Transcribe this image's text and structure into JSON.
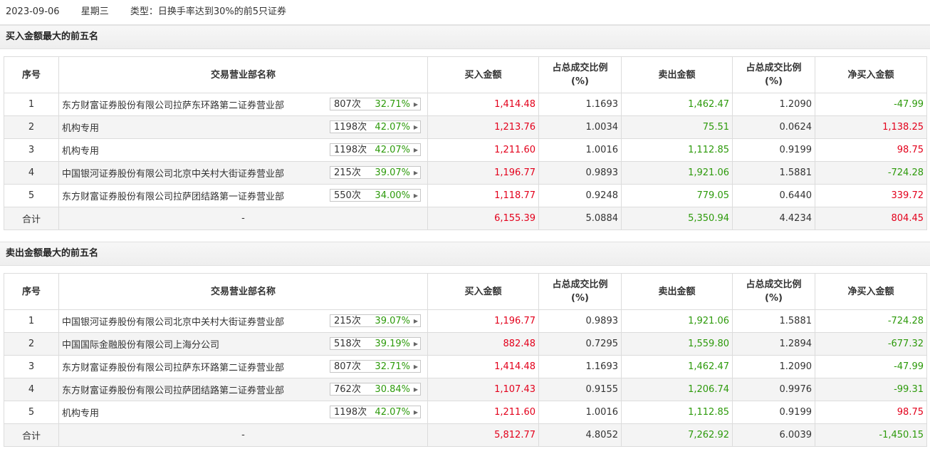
{
  "header": {
    "date": "2023-09-06",
    "weekday": "星期三",
    "type_label": "类型：日换手率达到30%的前5只证券"
  },
  "columns": [
    "序号",
    "交易营业部名称",
    "买入金额",
    "占总成交比例\n(%)",
    "卖出金额",
    "占总成交比例\n(%)",
    "净买入金额"
  ],
  "buy_section": {
    "title": "买入金额最大的前五名",
    "rows": [
      {
        "idx": "1",
        "name": "东方财富证券股份有限公司拉萨东环路第二证券营业部",
        "count": "807次",
        "pct": "32.71%",
        "buy": "1,414.48",
        "buy_ratio": "1.1693",
        "sell": "1,462.47",
        "sell_ratio": "1.2090",
        "net": "-47.99",
        "net_sign": "neg"
      },
      {
        "idx": "2",
        "name": "机构专用",
        "count": "1198次",
        "pct": "42.07%",
        "buy": "1,213.76",
        "buy_ratio": "1.0034",
        "sell": "75.51",
        "sell_ratio": "0.0624",
        "net": "1,138.25",
        "net_sign": "pos"
      },
      {
        "idx": "3",
        "name": "机构专用",
        "count": "1198次",
        "pct": "42.07%",
        "buy": "1,211.60",
        "buy_ratio": "1.0016",
        "sell": "1,112.85",
        "sell_ratio": "0.9199",
        "net": "98.75",
        "net_sign": "pos"
      },
      {
        "idx": "4",
        "name": "中国银河证券股份有限公司北京中关村大街证券营业部",
        "count": "215次",
        "pct": "39.07%",
        "buy": "1,196.77",
        "buy_ratio": "0.9893",
        "sell": "1,921.06",
        "sell_ratio": "1.5881",
        "net": "-724.28",
        "net_sign": "neg"
      },
      {
        "idx": "5",
        "name": "东方财富证券股份有限公司拉萨团结路第一证券营业部",
        "count": "550次",
        "pct": "34.00%",
        "buy": "1,118.77",
        "buy_ratio": "0.9248",
        "sell": "779.05",
        "sell_ratio": "0.6440",
        "net": "339.72",
        "net_sign": "pos"
      }
    ],
    "total": {
      "label": "合计",
      "name": "-",
      "buy": "6,155.39",
      "buy_ratio": "5.0884",
      "sell": "5,350.94",
      "sell_ratio": "4.4234",
      "net": "804.45",
      "net_sign": "pos"
    }
  },
  "sell_section": {
    "title": "卖出金额最大的前五名",
    "rows": [
      {
        "idx": "1",
        "name": "中国银河证券股份有限公司北京中关村大街证券营业部",
        "count": "215次",
        "pct": "39.07%",
        "buy": "1,196.77",
        "buy_ratio": "0.9893",
        "sell": "1,921.06",
        "sell_ratio": "1.5881",
        "net": "-724.28",
        "net_sign": "neg"
      },
      {
        "idx": "2",
        "name": "中国国际金融股份有限公司上海分公司",
        "count": "518次",
        "pct": "39.19%",
        "buy": "882.48",
        "buy_ratio": "0.7295",
        "sell": "1,559.80",
        "sell_ratio": "1.2894",
        "net": "-677.32",
        "net_sign": "neg"
      },
      {
        "idx": "3",
        "name": "东方财富证券股份有限公司拉萨东环路第二证券营业部",
        "count": "807次",
        "pct": "32.71%",
        "buy": "1,414.48",
        "buy_ratio": "1.1693",
        "sell": "1,462.47",
        "sell_ratio": "1.2090",
        "net": "-47.99",
        "net_sign": "neg"
      },
      {
        "idx": "4",
        "name": "东方财富证券股份有限公司拉萨团结路第二证券营业部",
        "count": "762次",
        "pct": "30.84%",
        "buy": "1,107.43",
        "buy_ratio": "0.9155",
        "sell": "1,206.74",
        "sell_ratio": "0.9976",
        "net": "-99.31",
        "net_sign": "neg"
      },
      {
        "idx": "5",
        "name": "机构专用",
        "count": "1198次",
        "pct": "42.07%",
        "buy": "1,211.60",
        "buy_ratio": "1.0016",
        "sell": "1,112.85",
        "sell_ratio": "0.9199",
        "net": "98.75",
        "net_sign": "pos"
      }
    ],
    "total": {
      "label": "合计",
      "name": "-",
      "buy": "5,812.77",
      "buy_ratio": "4.8052",
      "sell": "7,262.92",
      "sell_ratio": "6.0039",
      "net": "-1,450.15",
      "net_sign": "neg"
    }
  },
  "colors": {
    "positive": "#e3001b",
    "negative": "#2d9a0b",
    "header_bg": "#f0f0f0",
    "alt_row": "#f4f4f4"
  },
  "icons": {
    "badge_arrow": "caret-right-icon"
  }
}
